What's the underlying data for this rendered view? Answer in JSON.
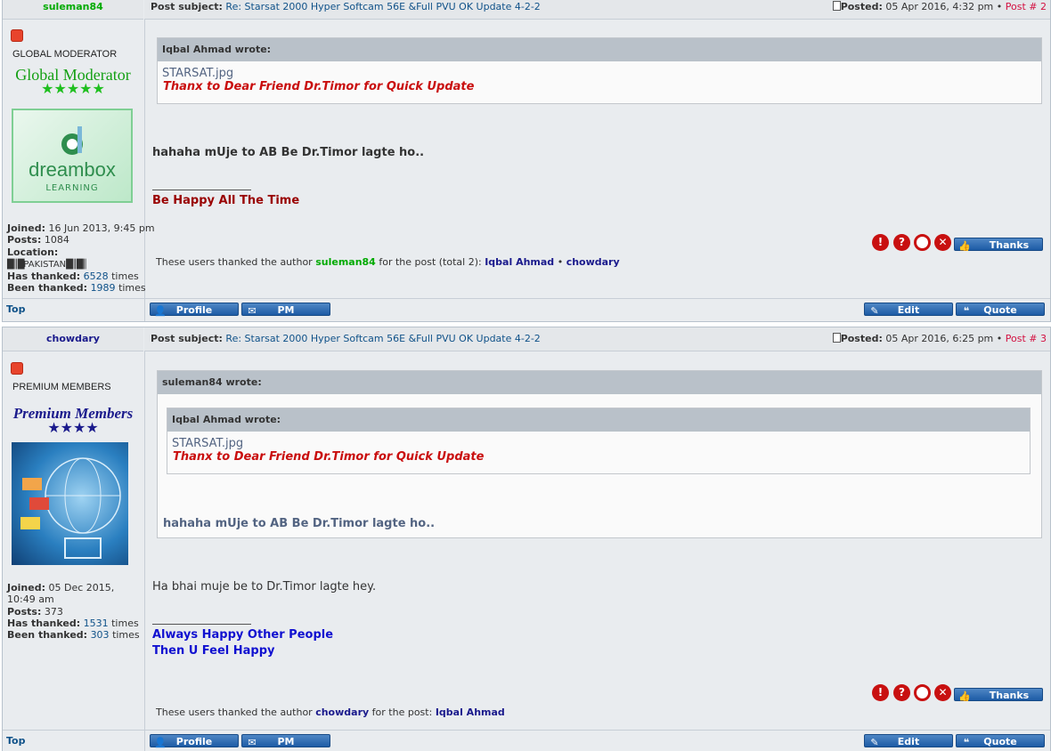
{
  "posts": [
    {
      "author": "suleman84",
      "author_color": "#00aa00",
      "subject_label": "Post subject:",
      "subject": "Re: Starsat 2000 Hyper Softcam 56E &Full PVU OK Update 4-2-2",
      "posted_label": "Posted:",
      "posted": "05 Apr 2016, 4:32 pm",
      "post_num": "Post # 2",
      "rank_title": "GLOBAL MODERATOR",
      "rank_image_text": "Global Moderator",
      "rank_stars": "★★★★★",
      "avatar_text": "dreambox",
      "avatar_sub": "LEARNING",
      "joined_label": "Joined:",
      "joined": "16 Jun 2013, 9:45 pm",
      "posts_label": "Posts:",
      "posts": "1084",
      "location_label": "Location:",
      "location": "PAKISTAN",
      "has_thanked_label": "Has thanked:",
      "has_thanked": "6528",
      "been_thanked_label": "Been thanked:",
      "been_thanked": "1989",
      "times": "times",
      "quote_author": "Iqbal Ahmad wrote:",
      "quote_file": "STARSAT.jpg",
      "quote_text": "Thanx to Dear Friend Dr.Timor for Quick Update",
      "message": "hahaha mUje to AB Be Dr.Timor lagte ho..",
      "signature": "Be Happy All The Time",
      "thanks_pre": "These users thanked the author",
      "thanks_mid": "for the post (total 2):",
      "thanks_users": [
        "Iqbal Ahmad",
        "chowdary"
      ]
    },
    {
      "author": "chowdary",
      "author_color": "#1a1a8c",
      "subject_label": "Post subject:",
      "subject": "Re: Starsat 2000 Hyper Softcam 56E &Full PVU OK Update 4-2-2",
      "posted_label": "Posted:",
      "posted": "05 Apr 2016, 6:25 pm",
      "post_num": "Post # 3",
      "rank_title": "PREMIUM MEMBERS",
      "rank_image_text": "Premium Members",
      "rank_stars": "★★★★",
      "joined_label": "Joined:",
      "joined": "05 Dec 2015, 10:49 am",
      "posts_label": "Posts:",
      "posts": "373",
      "has_thanked_label": "Has thanked:",
      "has_thanked": "1531",
      "been_thanked_label": "Been thanked:",
      "been_thanked": "303",
      "times": "times",
      "outer_quote_author": "suleman84 wrote:",
      "quote_author": "Iqbal Ahmad wrote:",
      "quote_file": "STARSAT.jpg",
      "quote_text": "Thanx to Dear Friend Dr.Timor for Quick Update",
      "outer_quote_text": "hahaha mUje to AB Be Dr.Timor lagte ho..",
      "message": "Ha bhai muje be to Dr.Timor lagte hey.",
      "signature_1": "Always Happy Other People",
      "signature_2": "Then U Feel Happy",
      "thanks_pre": "These users thanked the author",
      "thanks_mid": "for the post:",
      "thanks_users": [
        "Iqbal Ahmad"
      ]
    }
  ],
  "buttons": {
    "thanks": "Thanks",
    "profile": "Profile",
    "pm": "PM",
    "edit": "Edit",
    "quote": "Quote",
    "top": "Top",
    "separator": "•"
  },
  "report_icons": [
    "warning-icon",
    "info-icon",
    "ban-icon",
    "delete-icon"
  ],
  "colors": {
    "link": "#105289",
    "post_num": "#d31141",
    "quote_red": "#c90e0e",
    "button_blue": "#1d5ba5"
  }
}
